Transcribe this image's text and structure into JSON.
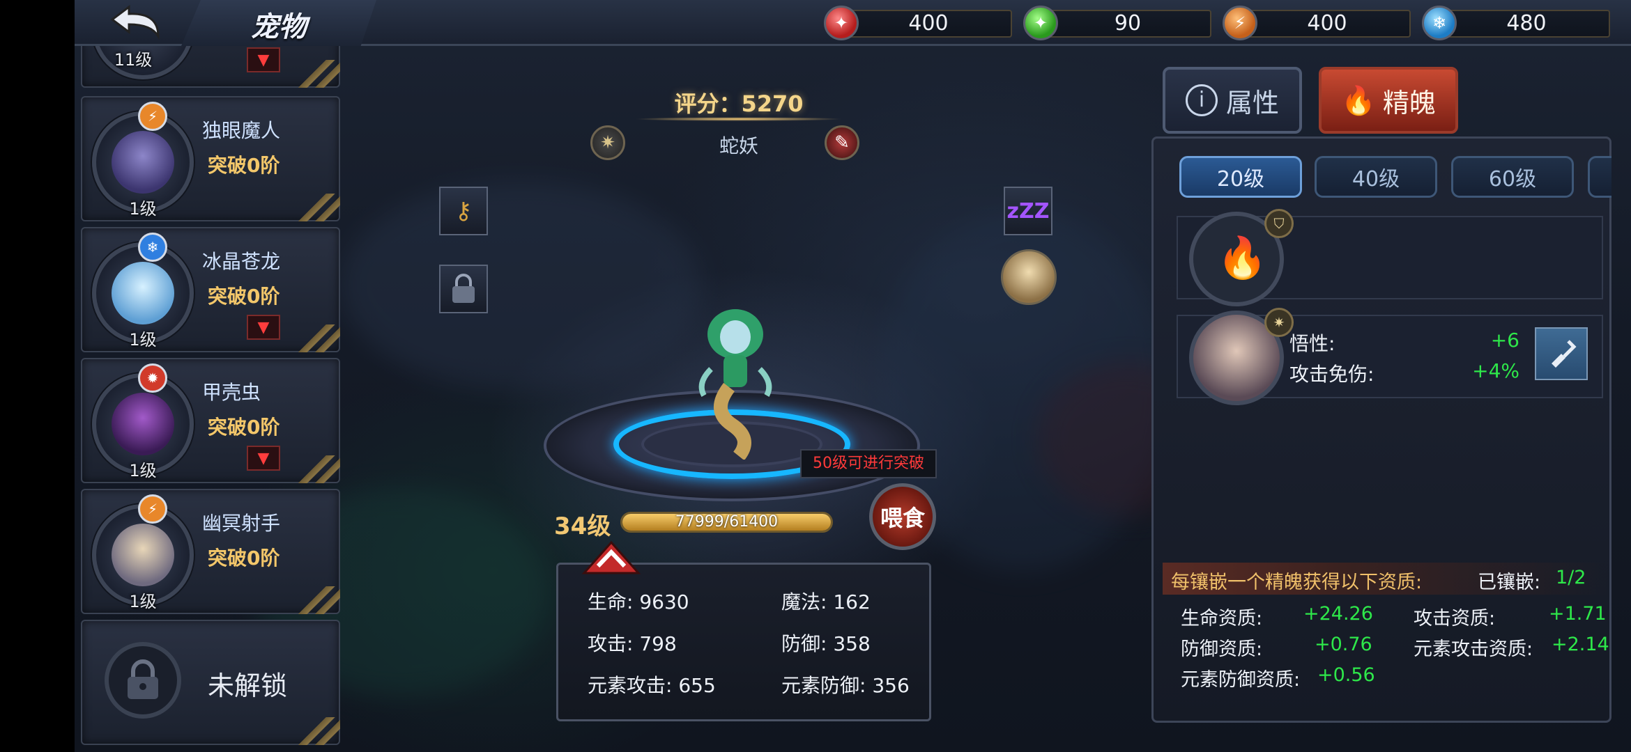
{
  "header": {
    "title": "宠物",
    "resources": [
      {
        "icon": "red-crystal-icon",
        "value": "400",
        "color": "#d93a3a"
      },
      {
        "icon": "green-crystal-icon",
        "value": "90",
        "color": "#43c43a"
      },
      {
        "icon": "lightning-orb-icon",
        "value": "400",
        "color": "#e8872a"
      },
      {
        "icon": "snowflake-orb-icon",
        "value": "480",
        "color": "#3aa7e8"
      }
    ]
  },
  "pet_list": {
    "partial_top": {
      "level": "11级"
    },
    "items": [
      {
        "name": "独眼魔人",
        "rank": "突破0阶",
        "level": "1级",
        "element": "lightning",
        "element_glyph": "⚡",
        "element_color": "#e8872a",
        "has_tag": false
      },
      {
        "name": "冰晶苍龙",
        "rank": "突破0阶",
        "level": "1级",
        "element": "ice",
        "element_glyph": "❄",
        "element_color": "#2f7fe0",
        "has_tag": true
      },
      {
        "name": "甲壳虫",
        "rank": "突破0阶",
        "level": "1级",
        "element": "fire",
        "element_glyph": "🔥",
        "element_color": "#d13a2a",
        "has_tag": true
      },
      {
        "name": "幽冥射手",
        "rank": "突破0阶",
        "level": "1级",
        "element": "lightning",
        "element_glyph": "⚡",
        "element_color": "#e8872a",
        "has_tag": false
      }
    ],
    "locked_label": "未解锁"
  },
  "pet_detail": {
    "score_label": "评分：5270",
    "name": "蛇妖",
    "level": "34级",
    "exp_text": "77999/61400",
    "exp_fraction": 1.0,
    "breakthrough_tip": "50级可进行突破",
    "feed_label": "喂食",
    "stats": {
      "hp": "生命: 9630",
      "mp": "魔法: 162",
      "atk": "攻击: 798",
      "def": "防御: 358",
      "elem_atk": "元素攻击: 655",
      "elem_def": "元素防御: 356"
    }
  },
  "right_panel": {
    "tabs": {
      "attributes": "属性",
      "spirit": "精魄"
    },
    "level_tabs": [
      "20级",
      "40级",
      "60级"
    ],
    "spirit_attrs": [
      {
        "label": "悟性:",
        "value": "+6"
      },
      {
        "label": "攻击免伤:",
        "value": "+4%"
      }
    ],
    "info_text": "每镶嵌一个精魄获得以下资质:",
    "inlaid_label": "已镶嵌:",
    "inlaid_value": "1/2",
    "qualities": [
      {
        "label": "生命资质:",
        "value": "+24.26"
      },
      {
        "label": "攻击资质:",
        "value": "+1.71"
      },
      {
        "label": "防御资质:",
        "value": "+0.76"
      },
      {
        "label": "元素攻击资质:",
        "value": "+2.14"
      },
      {
        "label": "元素防御资质:",
        "value": "+0.56"
      }
    ]
  }
}
